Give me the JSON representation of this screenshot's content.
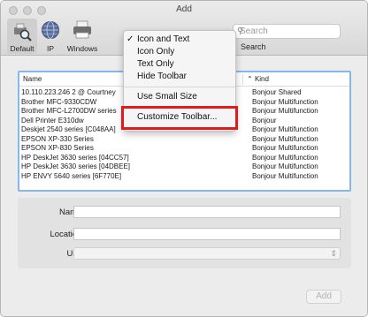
{
  "window": {
    "title": "Add"
  },
  "toolbar": {
    "items": [
      {
        "label": "Default",
        "icon": "printer-magnifier-icon"
      },
      {
        "label": "IP",
        "icon": "globe-icon"
      },
      {
        "label": "Windows",
        "icon": "printer-icon"
      }
    ],
    "search_placeholder": "Search",
    "search_label": "Search"
  },
  "context_menu": {
    "items": [
      {
        "label": "Icon and Text",
        "checked": true
      },
      {
        "label": "Icon Only"
      },
      {
        "label": "Text Only"
      },
      {
        "label": "Hide Toolbar"
      },
      {
        "label": "Use Small Size"
      },
      {
        "label": "Customize Toolbar..."
      }
    ],
    "highlight_color": "#e01b1b"
  },
  "printer_list": {
    "columns": {
      "name": "Name",
      "kind": "Kind"
    },
    "rows": [
      {
        "name": "10.110.223.246 2 @ Courtney",
        "kind": "Bonjour Shared"
      },
      {
        "name": "Brother MFC-9330CDW",
        "kind": "Bonjour Multifunction"
      },
      {
        "name": "Brother MFC-L2700DW series",
        "kind": "Bonjour Multifunction"
      },
      {
        "name": "Dell Printer E310dw",
        "kind": "Bonjour"
      },
      {
        "name": "Deskjet 2540 series [C048AA]",
        "kind": "Bonjour Multifunction"
      },
      {
        "name": "EPSON XP-330 Series",
        "kind": "Bonjour Multifunction"
      },
      {
        "name": "EPSON XP-830 Series",
        "kind": "Bonjour Multifunction"
      },
      {
        "name": "HP DeskJet 3630 series [04CC57]",
        "kind": "Bonjour Multifunction"
      },
      {
        "name": "HP DeskJet 3630 series [04DBEE]",
        "kind": "Bonjour Multifunction"
      },
      {
        "name": "HP ENVY 5640 series [6F770E]",
        "kind": "Bonjour Multifunction"
      }
    ]
  },
  "form": {
    "name_label": "Name:",
    "location_label": "Location:",
    "use_label": "Use:"
  },
  "footer": {
    "add_label": "Add"
  }
}
